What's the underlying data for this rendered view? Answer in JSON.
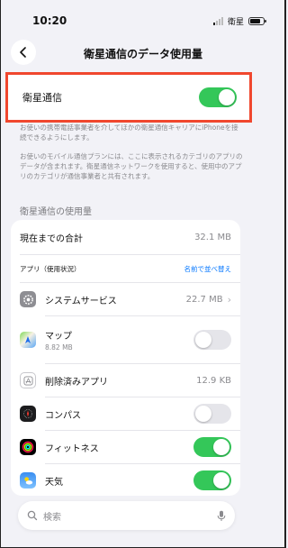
{
  "status_bar": {
    "time": "10:20",
    "carrier": "衛星"
  },
  "nav": {
    "title": "衛星通信のデータ使用量"
  },
  "satellite_toggle": {
    "label": "衛星通信",
    "on": true
  },
  "footnotes": [
    "お使いの携帯電話事業者を介してほかの衛星通信キャリアにiPhoneを接続できるようにします。",
    "お使いのモバイル通信プランには、ここに表示されるカテゴリのアプリのデータが含まれます。衛星通信ネットワークを使用すると、使用中のアプリのカテゴリが通信事業者と共有されます。"
  ],
  "usage_section": {
    "header": "衛星通信の使用量",
    "total_label": "現在までの合計",
    "total_value": "32.1 MB",
    "apps_label": "アプリ（使用状況）",
    "sort_label": "名前で並べ替え",
    "apps": [
      {
        "name": "システムサービス",
        "value": "22.7 MB",
        "kind": "detail"
      },
      {
        "name": "マップ",
        "sub": "8.82 MB",
        "kind": "toggle",
        "on": false
      },
      {
        "name": "削除済みアプリ",
        "value": "12.9 KB",
        "kind": "value"
      },
      {
        "name": "コンパス",
        "kind": "toggle",
        "on": false
      },
      {
        "name": "フィットネス",
        "kind": "toggle",
        "on": true
      },
      {
        "name": "天気",
        "kind": "toggle",
        "on": true
      }
    ]
  },
  "search": {
    "placeholder": "検索"
  },
  "colors": {
    "highlight": "#f0472e",
    "toggle_on": "#34c759",
    "link": "#0a7aff"
  }
}
